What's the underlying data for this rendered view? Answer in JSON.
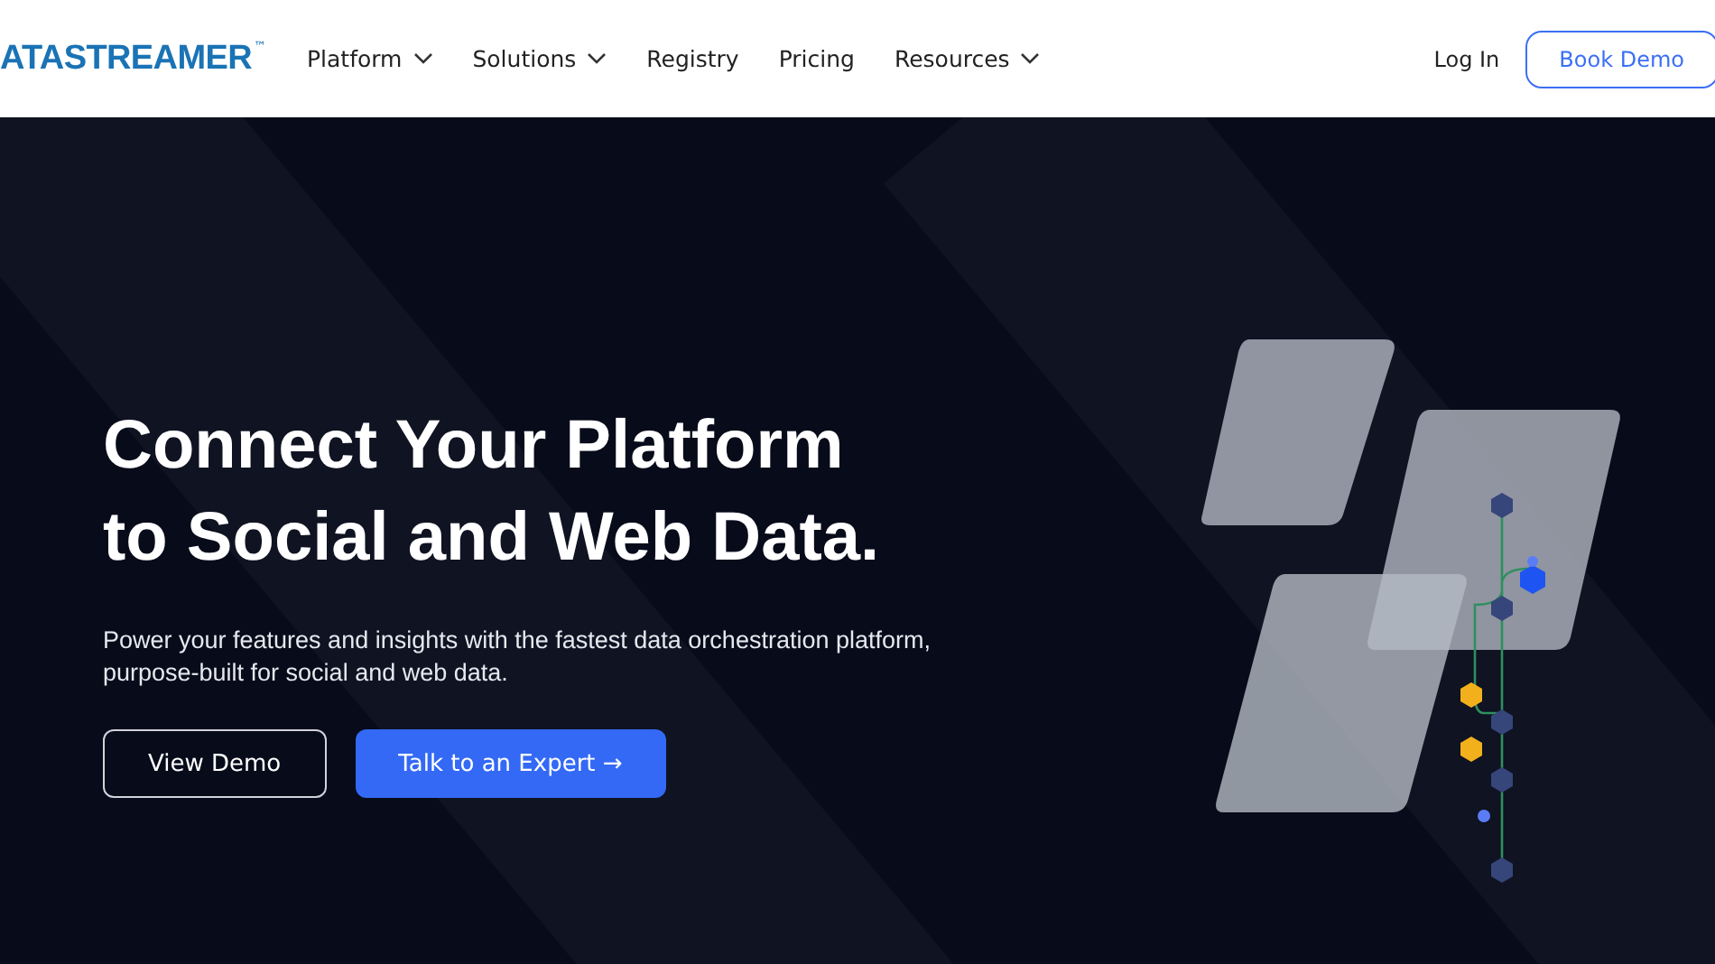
{
  "header": {
    "logo": {
      "text": "ATASTREAMER",
      "mark": "™"
    },
    "nav": [
      {
        "label": "Platform",
        "has_menu": true
      },
      {
        "label": "Solutions",
        "has_menu": true
      },
      {
        "label": "Registry",
        "has_menu": false
      },
      {
        "label": "Pricing",
        "has_menu": false
      },
      {
        "label": "Resources",
        "has_menu": true
      }
    ],
    "login": "Log In",
    "cta": "Book Demo"
  },
  "hero": {
    "title_lines": [
      "Connect Your Platform",
      "to Social and Web Data."
    ],
    "subtitle": "Power your features and insights with the fastest data orchestration platform, purpose-built for social and web data.",
    "buttons": [
      {
        "label": "View Demo",
        "kind": "outline"
      },
      {
        "label": "Talk to an Expert →",
        "kind": "primary"
      }
    ]
  }
}
